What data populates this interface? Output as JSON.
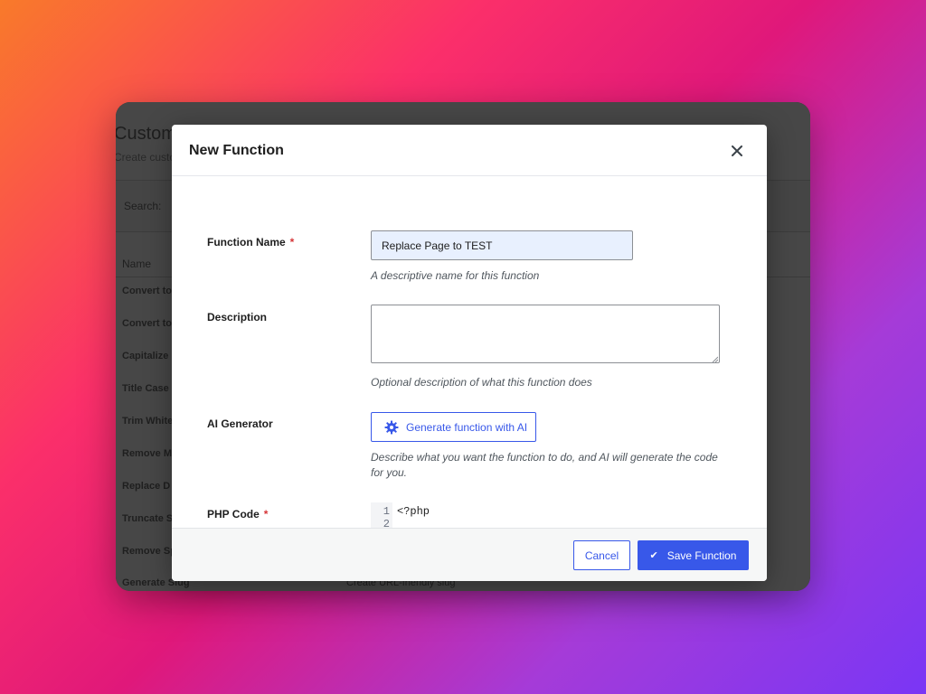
{
  "background_admin": {
    "title": "Custom",
    "subtitle": "Create custo",
    "search_label": "Search:",
    "column_name": "Name",
    "rows": [
      {
        "label": "Convert to",
        "desc": ""
      },
      {
        "label": "Convert to",
        "desc": ""
      },
      {
        "label": "Capitalize",
        "desc": ""
      },
      {
        "label": "Title Case",
        "desc": ""
      },
      {
        "label": "Trim White",
        "desc": ""
      },
      {
        "label": "Remove M",
        "desc": ""
      },
      {
        "label": "Replace D",
        "desc": ""
      },
      {
        "label": "Truncate S",
        "desc": ""
      },
      {
        "label": "Remove Sp",
        "desc": ""
      },
      {
        "label": "Generate Slug",
        "desc": "Create URL-friendly slug"
      }
    ]
  },
  "modal": {
    "title": "New Function",
    "close_icon": "close-icon",
    "fields": {
      "function_name": {
        "label": "Function Name",
        "required_mark": "*",
        "value": "Replace Page to TEST",
        "hint": "A descriptive name for this function"
      },
      "description": {
        "label": "Description",
        "value": "",
        "hint": "Optional description of what this function does"
      },
      "ai_generator": {
        "label": "AI Generator",
        "button_label": "Generate function with AI",
        "button_icon": "gear-icon",
        "hint": "Describe what you want the function to do, and AI will generate the code for you."
      },
      "php_code": {
        "label": "PHP Code",
        "required_mark": "*",
        "line_numbers": [
          "1",
          "2"
        ],
        "first_line": "<?php"
      }
    },
    "footer": {
      "cancel_label": "Cancel",
      "save_label": "Save Function",
      "save_icon": "check-icon"
    }
  },
  "colors": {
    "accent": "#3858e9",
    "required": "#d63638",
    "input_autofill_bg": "#e8f0fe"
  }
}
